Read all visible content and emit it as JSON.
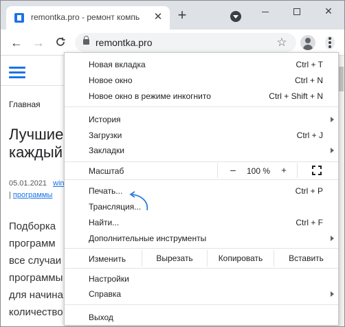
{
  "window": {
    "tab_title": "remontka.pro - ремонт компь",
    "tab_close": "✕",
    "new_tab": "+",
    "minimize": "",
    "maximize": "",
    "close": "✕"
  },
  "toolbar": {
    "back": "←",
    "forward": "→",
    "reload": "C",
    "url": "remontka.pro",
    "star": "☆"
  },
  "page": {
    "breadcrumb": "Главная",
    "title_lines": [
      "Лучшие",
      "каждый"
    ],
    "date": "05.01.2021",
    "author_link": "win",
    "category_prefix": "| ",
    "category": "программы",
    "body_lines": [
      "Подборка",
      "программ",
      "все  случаи",
      "программы",
      "для  начина",
      "количество"
    ]
  },
  "menu": {
    "new_tab": {
      "label": "Новая вкладка",
      "shortcut": "Ctrl + T"
    },
    "new_window": {
      "label": "Новое окно",
      "shortcut": "Ctrl + N"
    },
    "incognito": {
      "label": "Новое окно в режиме инкогнито",
      "shortcut": "Ctrl + Shift + N"
    },
    "history": {
      "label": "История"
    },
    "downloads": {
      "label": "Загрузки",
      "shortcut": "Ctrl + J"
    },
    "bookmarks": {
      "label": "Закладки"
    },
    "zoom": {
      "label": "Масштаб",
      "minus": "–",
      "value": "100 %",
      "plus": "+"
    },
    "print": {
      "label": "Печать...",
      "shortcut": "Ctrl + P"
    },
    "cast": {
      "label": "Трансляция..."
    },
    "find": {
      "label": "Найти...",
      "shortcut": "Ctrl + F"
    },
    "more_tools": {
      "label": "Дополнительные инструменты"
    },
    "edit": {
      "label": "Изменить",
      "cut": "Вырезать",
      "copy": "Копировать",
      "paste": "Вставить"
    },
    "settings": {
      "label": "Настройки"
    },
    "help": {
      "label": "Справка"
    },
    "exit": {
      "label": "Выход"
    }
  },
  "colors": {
    "accent": "#1a73e8",
    "annotation_arrow": "#2a7bd8"
  },
  "icons": [
    "favicon-icon",
    "close-icon",
    "plus-icon",
    "tab-search-icon",
    "back-icon",
    "forward-icon",
    "reload-icon",
    "lock-icon",
    "star-icon",
    "profile-icon",
    "kebab-menu-icon",
    "hamburger-icon",
    "fullscreen-icon",
    "chevron-right-icon"
  ]
}
